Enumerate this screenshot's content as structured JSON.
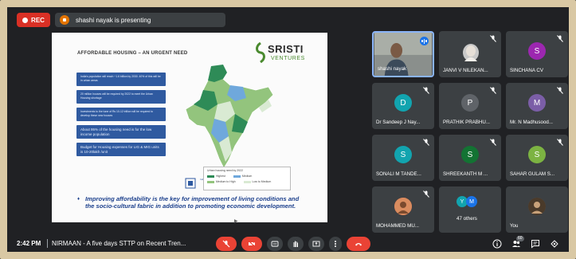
{
  "topbar": {
    "rec_label": "REC",
    "presenting_text": "shashi nayak is presenting"
  },
  "slide": {
    "title": "AFFORDABLE HOUSING – AN URGENT NEED",
    "logo_name": "SRISTI",
    "logo_sub": "VENTURES",
    "bullets": [
      "India's population will reach ~1.6 billion by 2030. 40% of this will be in urban areas",
      "20 million houses will be required by 2022 to meet the Urban Housing shortage",
      "Investments to the tune of Rs 10-12 trillion will be required to develop these new houses",
      "About 95% of the housing need is for the low income population",
      "Budget for Housing expenses for LIG & MIG units is 10-20lakh /unit"
    ],
    "map_caption": "Urban housing need by 2022",
    "legend": [
      {
        "label": "Highest",
        "color": "#2e8b57"
      },
      {
        "label": "Medium",
        "color": "#6fa8dc"
      },
      {
        "label": "Medium to High",
        "color": "#93c47d"
      },
      {
        "label": "Low to Medium",
        "color": "#d9ead3"
      }
    ],
    "gov_text": "India Habitat Centre",
    "conclusion": "Improving affordability is the key for improvement of living conditions and the socio-cultural fabric in addition to promoting economic development."
  },
  "participants": [
    {
      "name": "shashi nayak",
      "initial": "",
      "color": "#5f6368"
    },
    {
      "name": "JANVI V NILEKAN...",
      "initial": "",
      "color": "#5f6368"
    },
    {
      "name": "SINCHANA CV",
      "initial": "S",
      "color": "#9c27b0"
    },
    {
      "name": "Dr Sandeep J Nay...",
      "initial": "D",
      "color": "#12a4af"
    },
    {
      "name": "PRATHIK PRABHU...",
      "initial": "P",
      "color": "#5f6368"
    },
    {
      "name": "Mr. N Madhusood...",
      "initial": "M",
      "color": "#7b5ea7"
    },
    {
      "name": "SONALI M TANDE...",
      "initial": "S",
      "color": "#12a4af"
    },
    {
      "name": "SHREEKANTH M ...",
      "initial": "S",
      "color": "#137333"
    },
    {
      "name": "SAHAR GULAM S...",
      "initial": "S",
      "color": "#7cb342"
    },
    {
      "name": "MOHAMMED MU...",
      "initial": "",
      "color": "#5f6368"
    },
    {
      "name": "47 others",
      "initial": "",
      "color": "#3c4043"
    },
    {
      "name": "You",
      "initial": "",
      "color": "#5f6368"
    }
  ],
  "others_avatars": [
    "Y",
    "M"
  ],
  "bottom": {
    "time": "2:42 PM",
    "meeting_title": "NIRMAAN - A five days STTP on Recent Tren...",
    "participants_count": "60"
  },
  "colors": {
    "background": "#202124",
    "frame": "#d9c8a4",
    "end_call": "#ea4335",
    "rec": "#d93025",
    "active_border": "#8ab4f8"
  },
  "icons": [
    "mic-off-icon",
    "camera-off-icon",
    "captions-icon",
    "raise-hand-icon",
    "present-icon",
    "more-icon",
    "end-call-icon",
    "info-icon",
    "people-icon",
    "chat-icon",
    "activities-icon"
  ]
}
